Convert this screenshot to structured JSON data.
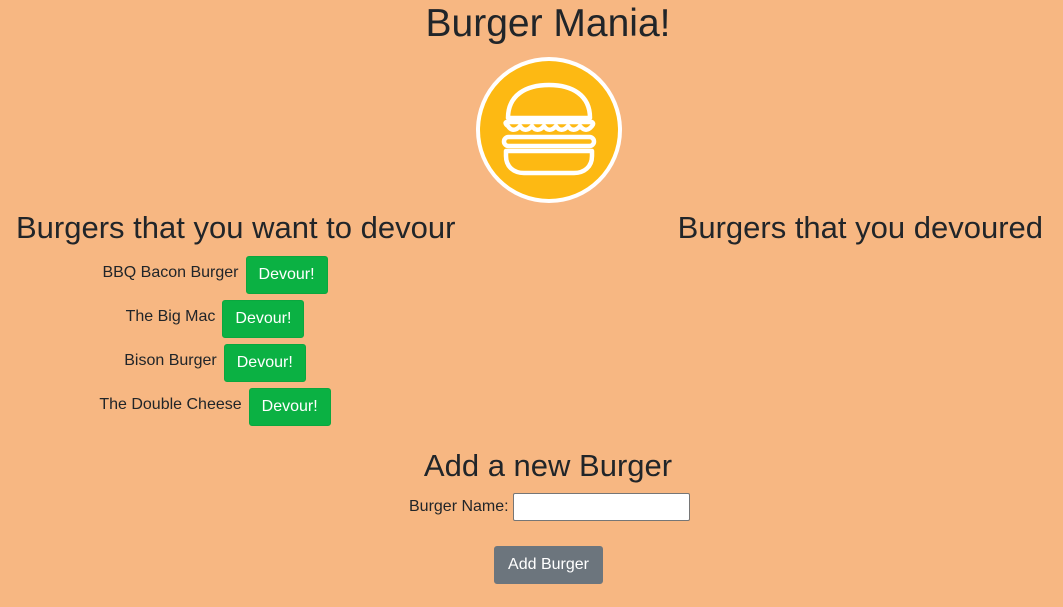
{
  "header": {
    "title": "Burger Mania!",
    "logo_icon": "burger-logo-icon"
  },
  "columns": {
    "to_devour_heading": "Burgers that you want to devour",
    "devoured_heading": "Burgers that you devoured"
  },
  "burgers": [
    {
      "name": "BBQ Bacon Burger",
      "button_label": "Devour!"
    },
    {
      "name": "The Big Mac",
      "button_label": "Devour!"
    },
    {
      "name": "Bison Burger",
      "button_label": "Devour!"
    },
    {
      "name": "The Double Cheese",
      "button_label": "Devour!"
    }
  ],
  "devoured_burgers": [],
  "add_form": {
    "heading": "Add a new Burger",
    "name_label": "Burger Name:",
    "name_value": "",
    "submit_label": "Add Burger"
  },
  "colors": {
    "background": "#f7b782",
    "devour_button": "#0bb143",
    "add_button": "#6c757d",
    "logo_fill": "#fdb913",
    "logo_ring": "#ffffff"
  }
}
